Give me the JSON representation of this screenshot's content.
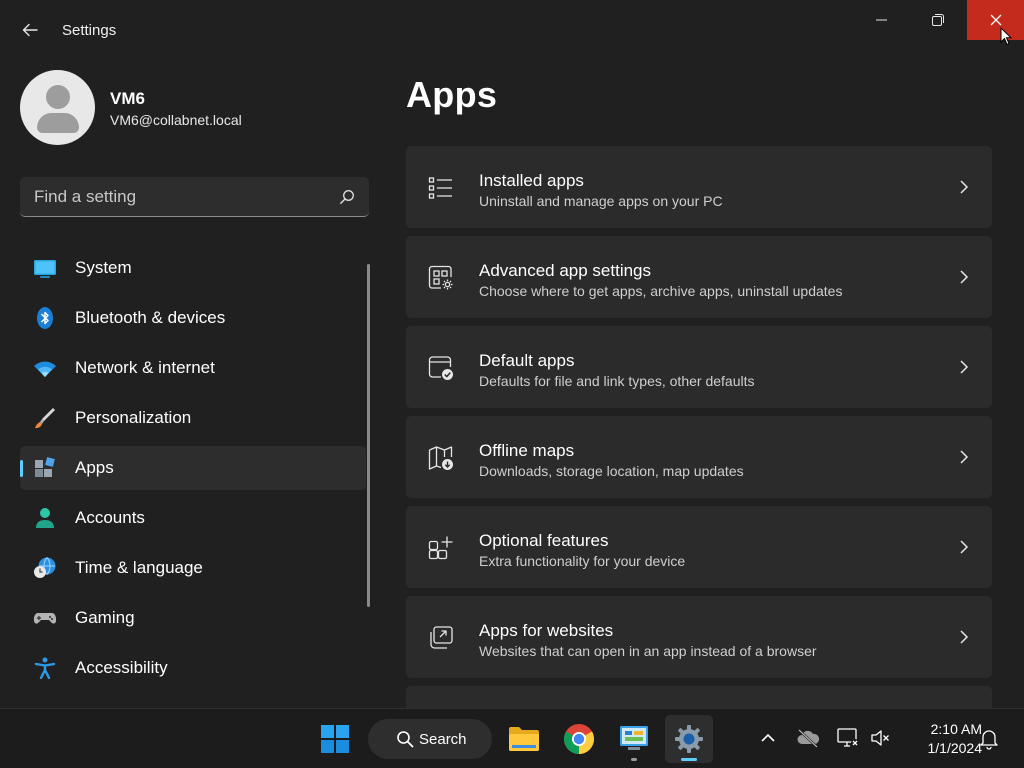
{
  "window": {
    "title": "Settings",
    "accent_close": "#c42b1c"
  },
  "profile": {
    "name": "VM6",
    "email": "VM6@collabnet.local"
  },
  "search": {
    "placeholder": "Find a setting"
  },
  "sidebar": {
    "items": [
      {
        "label": "System",
        "icon": "system-icon"
      },
      {
        "label": "Bluetooth & devices",
        "icon": "bluetooth-icon"
      },
      {
        "label": "Network & internet",
        "icon": "wifi-icon"
      },
      {
        "label": "Personalization",
        "icon": "paintbrush-icon"
      },
      {
        "label": "Apps",
        "icon": "apps-icon",
        "active": true
      },
      {
        "label": "Accounts",
        "icon": "accounts-icon"
      },
      {
        "label": "Time & language",
        "icon": "time-language-icon"
      },
      {
        "label": "Gaming",
        "icon": "gamepad-icon"
      },
      {
        "label": "Accessibility",
        "icon": "accessibility-icon"
      }
    ],
    "accent": "#60cdff"
  },
  "main": {
    "title": "Apps",
    "cards": [
      {
        "title": "Installed apps",
        "subtitle": "Uninstall and manage apps on your PC",
        "icon": "installed-apps-icon"
      },
      {
        "title": "Advanced app settings",
        "subtitle": "Choose where to get apps, archive apps, uninstall updates",
        "icon": "advanced-app-settings-icon"
      },
      {
        "title": "Default apps",
        "subtitle": "Defaults for file and link types, other defaults",
        "icon": "default-apps-icon"
      },
      {
        "title": "Offline maps",
        "subtitle": "Downloads, storage location, map updates",
        "icon": "offline-maps-icon"
      },
      {
        "title": "Optional features",
        "subtitle": "Extra functionality for your device",
        "icon": "optional-features-icon"
      },
      {
        "title": "Apps for websites",
        "subtitle": "Websites that can open in an app instead of a browser",
        "icon": "apps-for-websites-icon"
      }
    ]
  },
  "taskbar": {
    "search_label": "Search",
    "time": "2:10 AM",
    "date": "1/1/2024"
  }
}
